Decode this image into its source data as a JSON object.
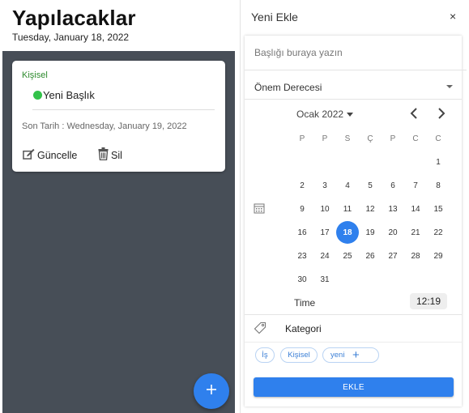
{
  "app": {
    "title": "Yapılacaklar",
    "date": "Tuesday, January 18, 2022"
  },
  "todo_card": {
    "category": "Kişisel",
    "title": "Yeni Başlık",
    "due": "Son Tarih : Wednesday, January 19, 2022",
    "edit_label": "Güncelle",
    "delete_label": "Sil",
    "status_color": "#33c24a"
  },
  "fab": {
    "icon": "plus-icon"
  },
  "panel": {
    "title": "Yeni Ekle",
    "close": "×",
    "title_placeholder": "Başlığı buraya yazın",
    "priority_label": "Önem Derecesi",
    "calendar": {
      "month_label": "Ocak 2022",
      "weekdays": [
        "P",
        "P",
        "S",
        "Ç",
        "P",
        "C",
        "C"
      ],
      "weeks": [
        [
          "",
          "",
          "",
          "",
          "",
          "",
          "1"
        ],
        [
          "2",
          "3",
          "4",
          "5",
          "6",
          "7",
          "8"
        ],
        [
          "9",
          "10",
          "11",
          "12",
          "13",
          "14",
          "15"
        ],
        [
          "16",
          "17",
          "18",
          "19",
          "20",
          "21",
          "22"
        ],
        [
          "23",
          "24",
          "25",
          "26",
          "27",
          "28",
          "29"
        ],
        [
          "30",
          "31",
          "",
          "",
          "",
          "",
          ""
        ]
      ],
      "selected_day": "18",
      "accent": "#2f80ed"
    },
    "time_label": "Time",
    "time_value": "12:19",
    "category_label": "Kategori",
    "categories": [
      "İş",
      "Kişisel"
    ],
    "new_category_value": "yeni",
    "submit_label": "EKLE"
  }
}
